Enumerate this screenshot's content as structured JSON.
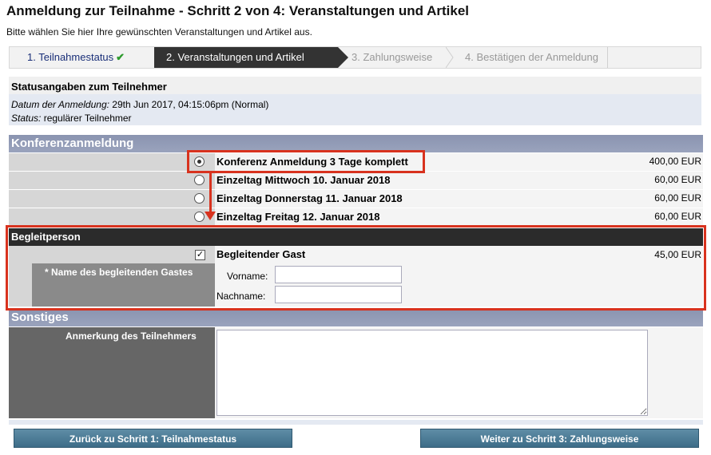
{
  "header": {
    "title": "Anmeldung zur Teilnahme - Schritt 2 von 4: Veranstaltungen und Artikel",
    "subtitle": "Bitte wählen Sie hier Ihre gewünschten Veranstaltungen und Artikel aus."
  },
  "stepper": {
    "steps": [
      {
        "label": "1. Teilnahmestatus",
        "state": "done",
        "check": "✔"
      },
      {
        "label": "2. Veranstaltungen und Artikel",
        "state": "active"
      },
      {
        "label": "3. Zahlungsweise",
        "state": "pending"
      },
      {
        "label": "4. Bestätigen der Anmeldung",
        "state": "pending"
      }
    ]
  },
  "status": {
    "title": "Statusangaben zum Teilnehmer",
    "date_label": "Datum der Anmeldung:",
    "date_value": "29th Jun 2017, 04:15:06pm (Normal)",
    "status_label": "Status:",
    "status_value": "regulärer Teilnehmer"
  },
  "konferenz": {
    "header": "Konferenzanmeldung",
    "options": [
      {
        "label": "Konferenz Anmeldung 3 Tage komplett",
        "price": "400,00 EUR",
        "selected": true
      },
      {
        "label": "Einzeltag Mittwoch 10. Januar 2018",
        "price": "60,00 EUR",
        "selected": false
      },
      {
        "label": "Einzeltag Donnerstag 11. Januar 2018",
        "price": "60,00 EUR",
        "selected": false
      },
      {
        "label": "Einzeltag Freitag 12. Januar 2018",
        "price": "60,00 EUR",
        "selected": false
      }
    ]
  },
  "begleitperson": {
    "header": "Begleitperson",
    "guest_label": "Begleitender Gast",
    "guest_price": "45,00 EUR",
    "guest_checked": true,
    "name_label": "* Name des begleitenden Gastes",
    "vorname_label": "Vorname:",
    "vorname_value": "",
    "nachname_label": "Nachname:",
    "nachname_value": ""
  },
  "sonstiges": {
    "header": "Sonstiges",
    "anmerkung_label": "Anmerkung des Teilnehmers",
    "anmerkung_value": ""
  },
  "buttons": {
    "back": "Zurück zu Schritt 1: Teilnahmestatus",
    "next": "Weiter zu Schritt 3: Zahlungsweise"
  },
  "colors": {
    "highlight": "#d8321e",
    "section_header": "#8a94b0",
    "button": "#4a7b96",
    "active_step": "#333333"
  }
}
